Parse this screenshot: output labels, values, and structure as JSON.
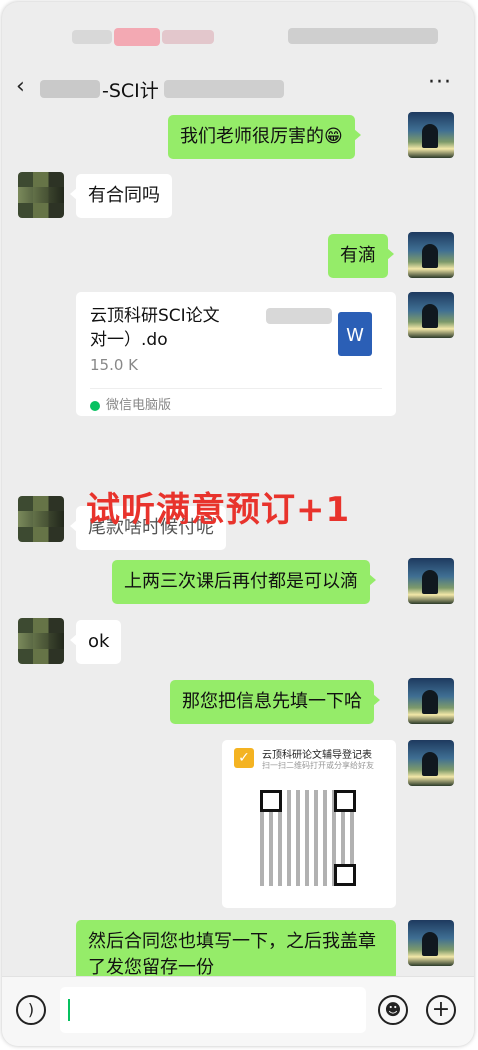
{
  "header": {
    "title": "-SCI计",
    "back_icon": "chevron-left-icon",
    "more_label": "···"
  },
  "messages": [
    {
      "side": "right",
      "text": "我们老师很厉害的😁"
    },
    {
      "side": "left",
      "text": "有合同吗"
    },
    {
      "side": "right",
      "text": "有滴"
    },
    {
      "side": "left",
      "type": "file"
    },
    {
      "side": "left",
      "text": "尾款啥时候付呢"
    },
    {
      "side": "right",
      "text": "上两三次课后再付都是可以滴"
    },
    {
      "side": "left",
      "text": "ok"
    },
    {
      "side": "right",
      "text": "那您把信息先填一下哈"
    },
    {
      "side": "right",
      "type": "mini-program"
    },
    {
      "side": "right",
      "text": "然后合同您也填写一下，之后我盖章了发您留存一份"
    }
  ],
  "file_card": {
    "name_line1": "云顶科研SCI论文",
    "name_line2": "对一）.do",
    "size": "15.0 K",
    "source": "微信电脑版",
    "icon_label": "W"
  },
  "mini_program": {
    "title": "云顶科研论文辅导登记表",
    "subtitle": "扫一扫二维码打开或分享给好友"
  },
  "overlay": {
    "text": "试听满意预订+1",
    "color": "#e8332c"
  },
  "bottom_bar": {
    "voice_icon": "voice-icon",
    "emoji_icon": "emoji-icon",
    "plus_icon": "plus-icon",
    "input_value": ""
  },
  "colors": {
    "sent_bubble": "#95ec69",
    "received_bubble": "#ffffff",
    "background": "#ededed"
  }
}
